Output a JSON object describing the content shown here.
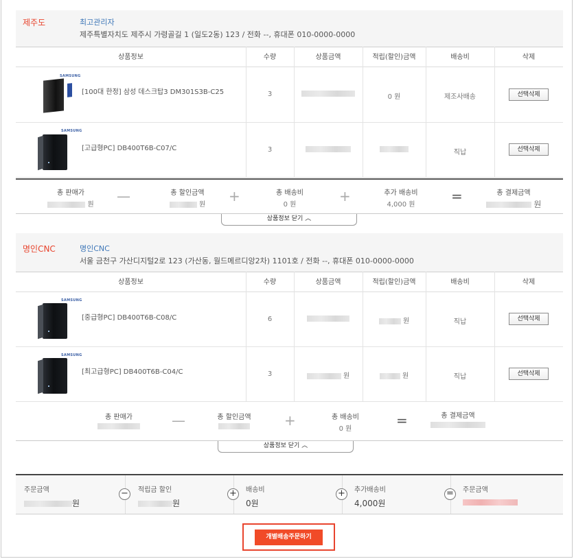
{
  "group1": {
    "region": "제주도",
    "name": "최고관리자",
    "address": "제주특별자치도 제주시 가령골길 1 (일도2동) 123 / 전화 --, 휴대폰 010-0000-0000",
    "headers": [
      "상품정보",
      "수량",
      "상품금액",
      "적립(할인)금액",
      "배송비",
      "삭제"
    ],
    "items": [
      {
        "name": "[100대 한정] 삼성 데스크탑3 DM301S3B-C25",
        "qty": "3",
        "point": "0 원",
        "shipping": "제조사배송",
        "delete": "선택삭제",
        "brand": "SAMSUNG"
      },
      {
        "name": "[고급형PC] DB400T6B-C07/C",
        "qty": "3",
        "point": "",
        "shipping": "직납",
        "delete": "선택삭제",
        "brand": "SAMSUNG"
      }
    ],
    "summary": {
      "sale_label": "총 판매가",
      "sale_unit": "원",
      "discount_label": "총 할인금액",
      "discount_unit": "원",
      "ship_label": "총 배송비",
      "ship_value": "0 원",
      "extra_label": "추가 배송비",
      "extra_value": "4,000 원",
      "total_label": "총 결제금액",
      "total_unit": "원",
      "op_minus": "—",
      "op_plus": "+",
      "op_eq": "="
    },
    "toggle": "상품정보 닫기 ︿"
  },
  "group2": {
    "region": "명인CNC",
    "name": "명인CNC",
    "address": "서울 금천구 가산디지털2로 123 (가산동, 월드메르디앙2차) 1101호 / 전화 --, 휴대폰 010-0000-0000",
    "headers": [
      "상품정보",
      "수량",
      "상품금액",
      "적립(할인)금액",
      "배송비",
      "삭제"
    ],
    "items": [
      {
        "name": "[중급형PC] DB400T6B-C08/C",
        "qty": "6",
        "price_unit": "",
        "point_unit": "원",
        "shipping": "직납",
        "delete": "선택삭제",
        "brand": "SAMSUNG"
      },
      {
        "name": "[최고급형PC] DB400T6B-C04/C",
        "qty": "3",
        "price_unit": "원",
        "point_unit": "원",
        "shipping": "직납",
        "delete": "선택삭제",
        "brand": "SAMSUNG"
      }
    ],
    "summary": {
      "sale_label": "총 판매가",
      "discount_label": "총 할인금액",
      "ship_label": "총 배송비",
      "ship_value": "0 원",
      "total_label": "총 결제금액",
      "op_minus": "—",
      "op_plus": "+",
      "op_eq": "="
    },
    "toggle": "상품정보 닫기 ︿"
  },
  "grand": {
    "order_label": "주문금액",
    "order_unit": "원",
    "point_label": "적립금 할인",
    "point_unit": "원",
    "ship_label": "배송비",
    "ship_value": "0원",
    "extra_label": "추가배송비",
    "extra_value": "4,000원",
    "final_label": "주문금액",
    "op_minus": "−",
    "op_plus": "+",
    "op_eq": "="
  },
  "order_button": "개별배송주문하기",
  "colors": {
    "accent": "#e8442d",
    "link": "#3e77b8",
    "button": "#f14b28"
  }
}
